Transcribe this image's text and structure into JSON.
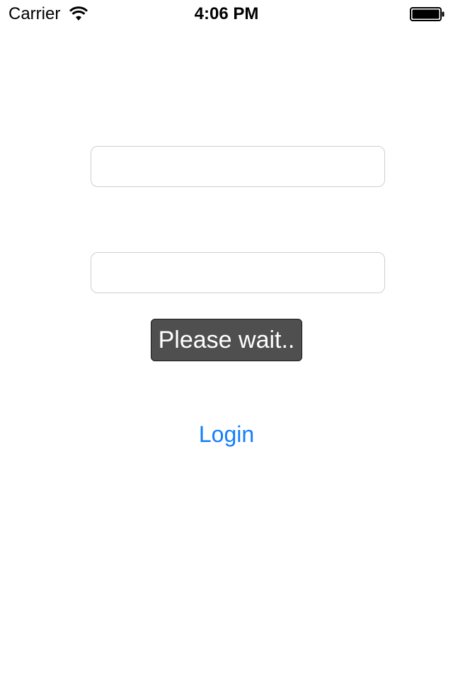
{
  "status_bar": {
    "carrier": "Carrier",
    "time": "4:06 PM",
    "wifi_icon": "wifi-icon",
    "battery_icon": "battery-icon"
  },
  "form": {
    "username_value": "",
    "password_value": "",
    "login_label": "Login"
  },
  "toast": {
    "message": "Please wait.."
  },
  "colors": {
    "accent": "#147efb",
    "toast_background": "#4f4f4f",
    "field_border": "#cfcfd4"
  }
}
